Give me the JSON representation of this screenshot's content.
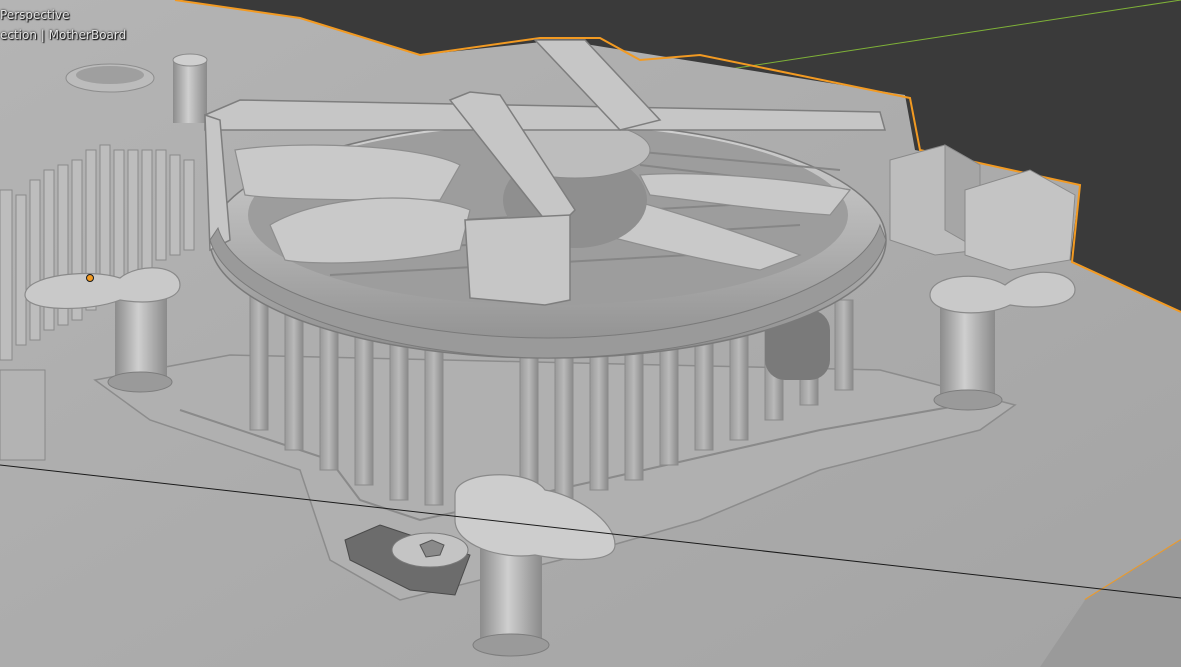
{
  "viewport": {
    "view_label": "Perspective",
    "collection_label": "ection | MotherBoard",
    "selected_object": "MotherBoard"
  },
  "colors": {
    "background": "#3a3a3a",
    "board": "#a9a9a9",
    "selection_outline": "#f29a22",
    "grid_axis_y": "#7fb238",
    "model_light": "#c8c8c8",
    "model_mid": "#a2a2a2",
    "model_dark": "#6e6e6e"
  },
  "icons": [
    "object-origin-icon"
  ]
}
